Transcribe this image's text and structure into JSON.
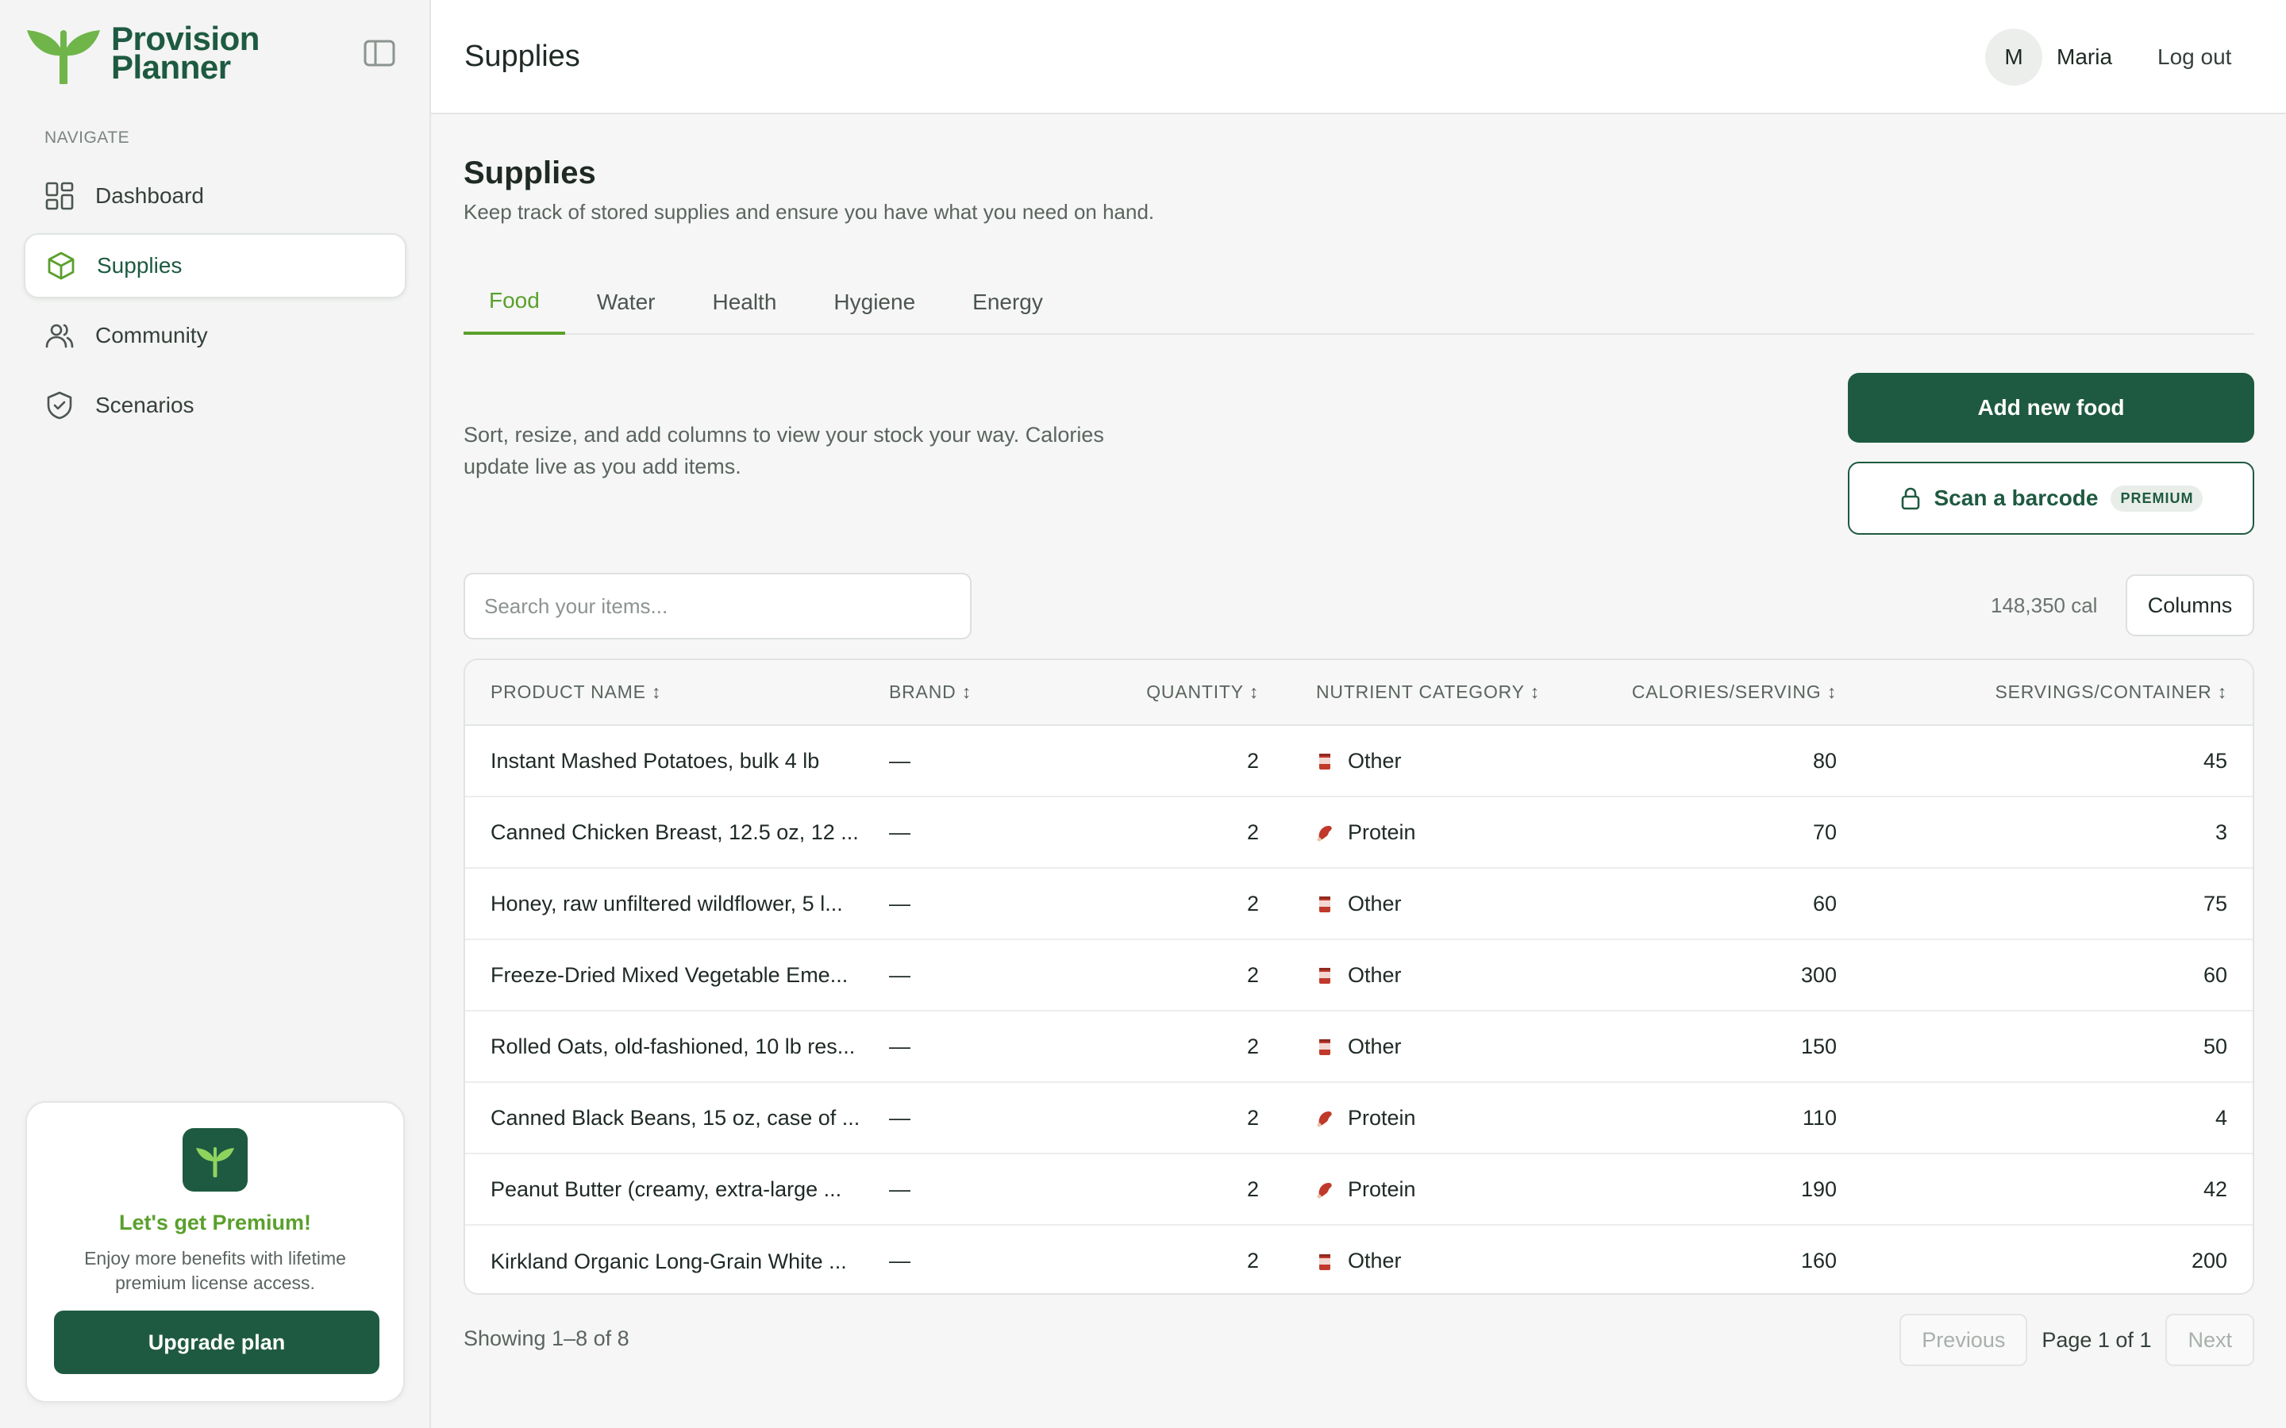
{
  "app": {
    "name_line1": "Provision",
    "name_line2": "Planner"
  },
  "sidebar": {
    "nav_heading": "NAVIGATE",
    "items": [
      {
        "label": "Dashboard",
        "icon": "dashboard-grid-icon"
      },
      {
        "label": "Supplies",
        "icon": "box-icon",
        "active": true
      },
      {
        "label": "Community",
        "icon": "users-icon"
      },
      {
        "label": "Scenarios",
        "icon": "shield-check-icon"
      }
    ],
    "premium": {
      "title": "Let's get Premium!",
      "description": "Enjoy more benefits with lifetime premium license access.",
      "button": "Upgrade plan"
    }
  },
  "topbar": {
    "title": "Supplies",
    "avatar_initial": "M",
    "user_name": "Maria",
    "logout": "Log out"
  },
  "main": {
    "title": "Supplies",
    "subtitle": "Keep track of stored supplies and ensure you have what you need on hand.",
    "tabs": [
      {
        "label": "Food",
        "active": true
      },
      {
        "label": "Water"
      },
      {
        "label": "Health"
      },
      {
        "label": "Hygiene"
      },
      {
        "label": "Energy"
      }
    ],
    "intro": "Sort, resize, and add columns to view your stock your way. Calories update live as you add items.",
    "add_button": "Add new food",
    "scan_button": "Scan a barcode",
    "premium_tag": "PREMIUM",
    "search_placeholder": "Search your items...",
    "calorie_total": "148,350 cal",
    "columns_button": "Columns"
  },
  "table": {
    "headers": {
      "name": "PRODUCT NAME ↕",
      "brand": "BRAND ↕",
      "quantity": "QUANTITY ↕",
      "category": "NUTRIENT CATEGORY ↕",
      "calories": "CALORIES/SERVING ↕",
      "servings": "SERVINGS/CONTAINER ↕"
    },
    "rows": [
      {
        "name": "Instant Mashed Potatoes, bulk 4 lb",
        "brand": "—",
        "quantity": "2",
        "category": "Other",
        "calories": "80",
        "servings": "45"
      },
      {
        "name": "Canned Chicken Breast, 12.5 oz, 12 ...",
        "brand": "—",
        "quantity": "2",
        "category": "Protein",
        "calories": "70",
        "servings": "3"
      },
      {
        "name": "Honey, raw unfiltered wildflower, 5 l...",
        "brand": "—",
        "quantity": "2",
        "category": "Other",
        "calories": "60",
        "servings": "75"
      },
      {
        "name": "Freeze-Dried Mixed Vegetable Eme...",
        "brand": "—",
        "quantity": "2",
        "category": "Other",
        "calories": "300",
        "servings": "60"
      },
      {
        "name": "Rolled Oats, old-fashioned, 10 lb res...",
        "brand": "—",
        "quantity": "2",
        "category": "Other",
        "calories": "150",
        "servings": "50"
      },
      {
        "name": "Canned Black Beans, 15 oz, case of ...",
        "brand": "—",
        "quantity": "2",
        "category": "Protein",
        "calories": "110",
        "servings": "4"
      },
      {
        "name": "Peanut Butter (creamy, extra-large ...",
        "brand": "—",
        "quantity": "2",
        "category": "Protein",
        "calories": "190",
        "servings": "42"
      },
      {
        "name": "Kirkland Organic Long-Grain White ...",
        "brand": "—",
        "quantity": "2",
        "category": "Other",
        "calories": "160",
        "servings": "200"
      }
    ]
  },
  "footer": {
    "showing": "Showing 1–8 of 8",
    "previous": "Previous",
    "page_info": "Page 1 of 1",
    "next": "Next"
  },
  "colors": {
    "brand_dark": "#1e5a41",
    "brand_green": "#5aa02c",
    "category_icon": "#c0392b"
  }
}
